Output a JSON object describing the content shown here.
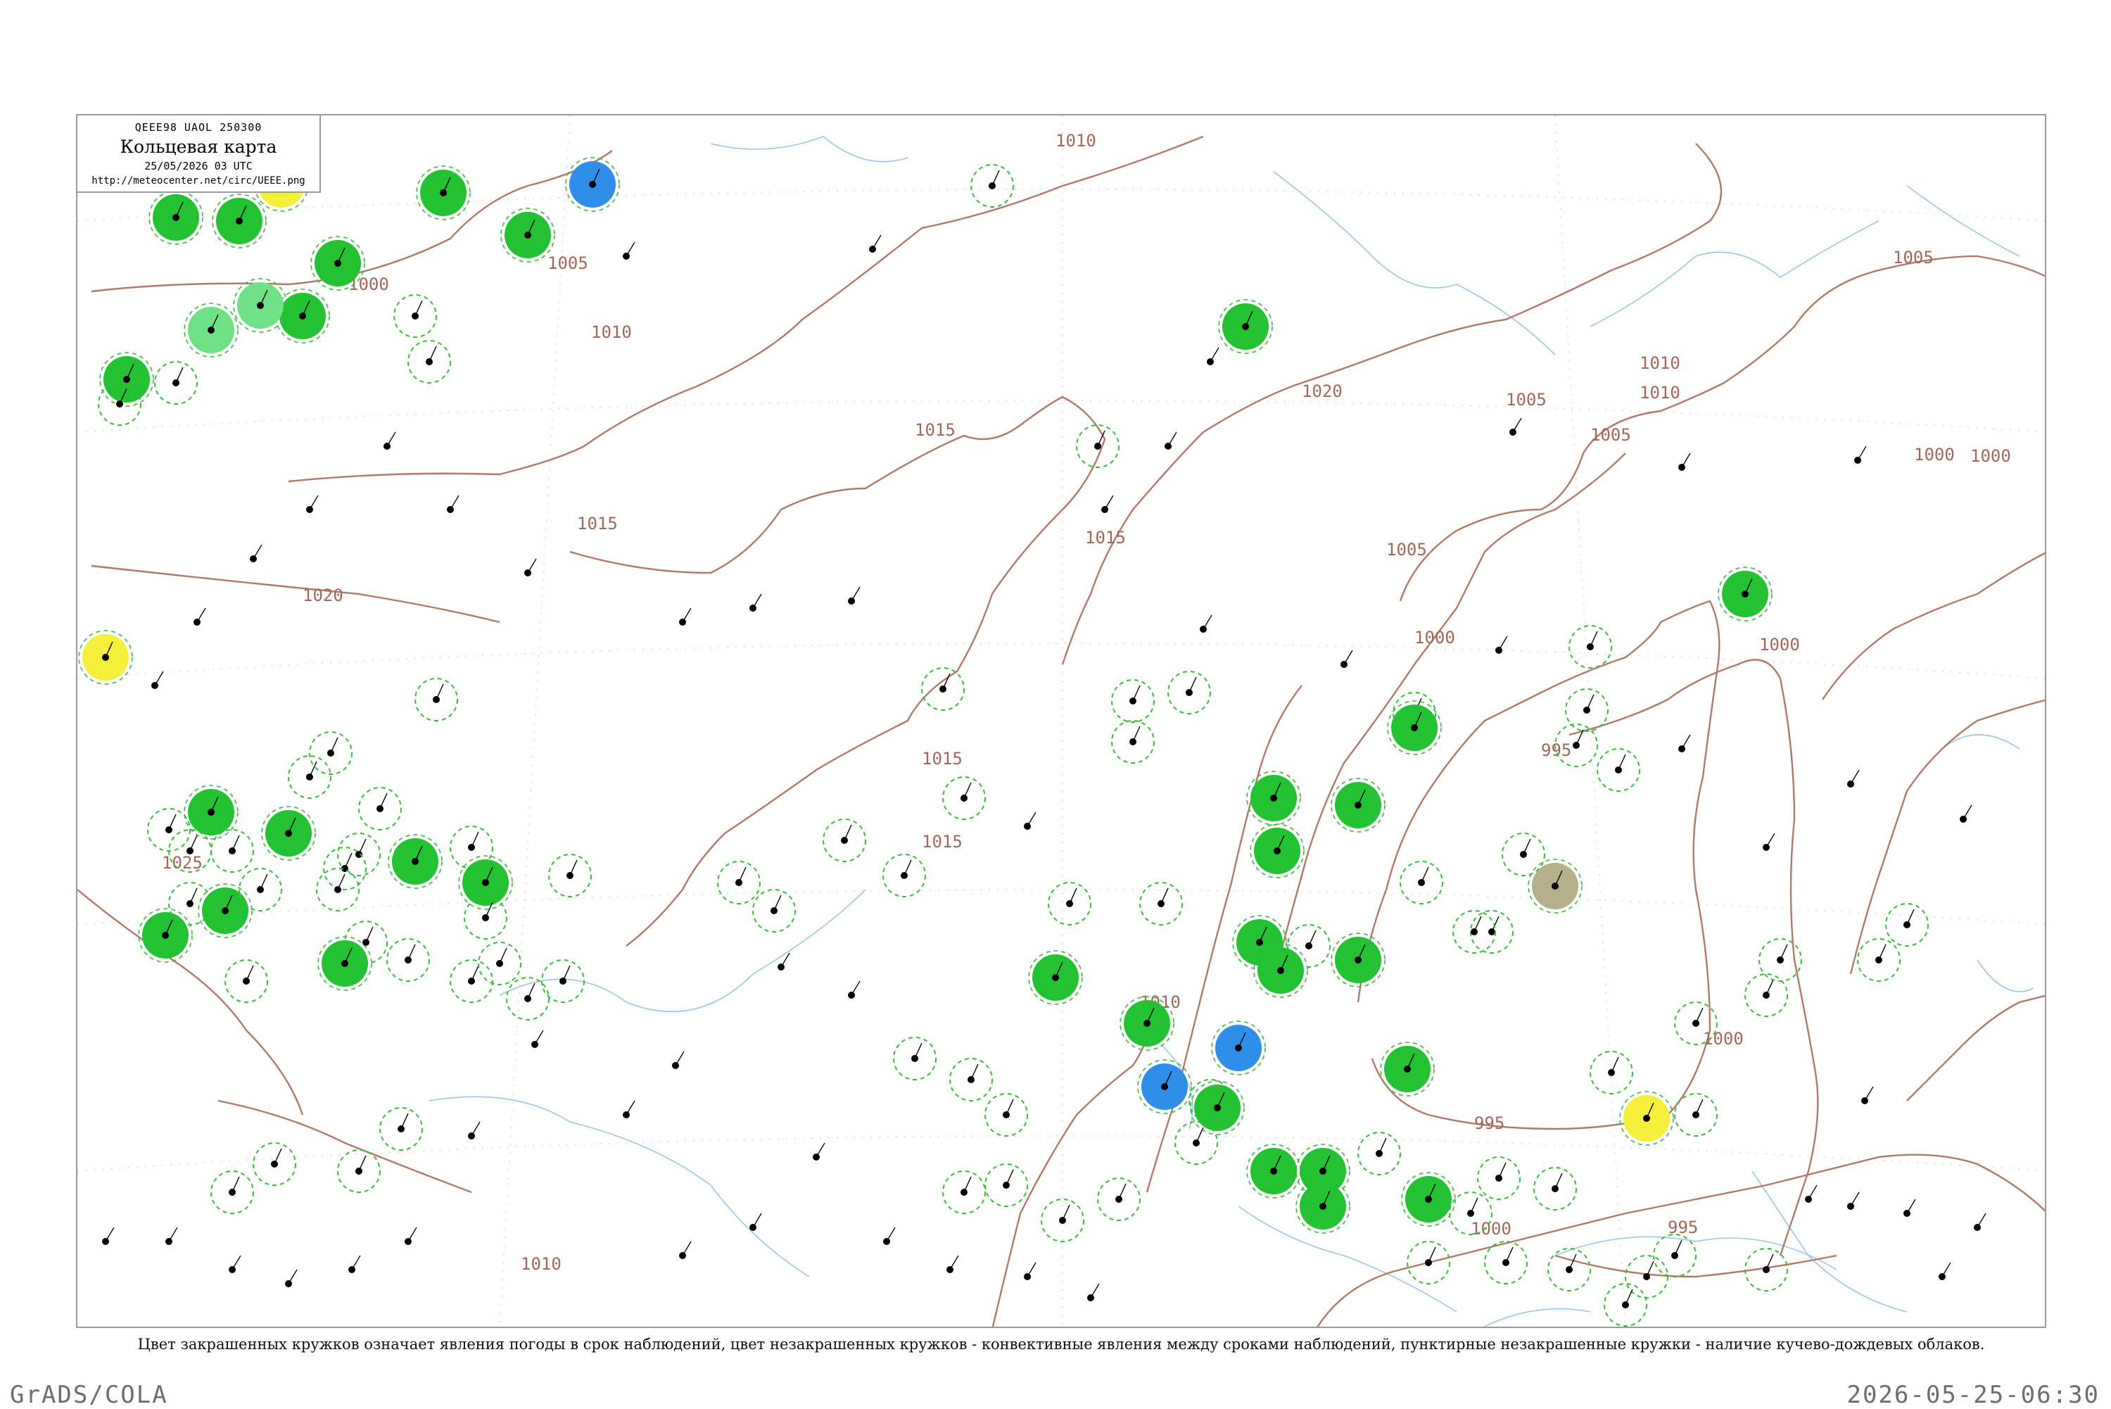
{
  "title_box": {
    "code": "QEEE98  UAOL  250300",
    "name": "Кольцевая карта",
    "time": "25/05/2026 03 UTC",
    "url": "http://meteocenter.net/circ/UEEE.png"
  },
  "isobar_labels": [
    "1000",
    "1005",
    "1010",
    "1015",
    "1020",
    "1025",
    "995"
  ],
  "colors": {
    "precip_green": "#22c232",
    "shower_lightgreen": "#6ee086",
    "fog_blue": "#2f8fe8",
    "haze_yellow": "#f5ee3a",
    "dust_olive": "#b5b08a",
    "convective_dashed": "#3cba3c",
    "isobar": "#b07a6a",
    "water": "#9cc6ec"
  },
  "caption": "Цвет закрашенных кружков означает явления погоды в срок наблюдений, цвет незакрашенных кружков - конвективные явления между сроками наблюдений, пунктирные незакрашенные кружки - наличие кучево-дождевых облаков.",
  "footer": {
    "left": "GrADS/COLA",
    "right": "2026-05-25-06:30"
  }
}
